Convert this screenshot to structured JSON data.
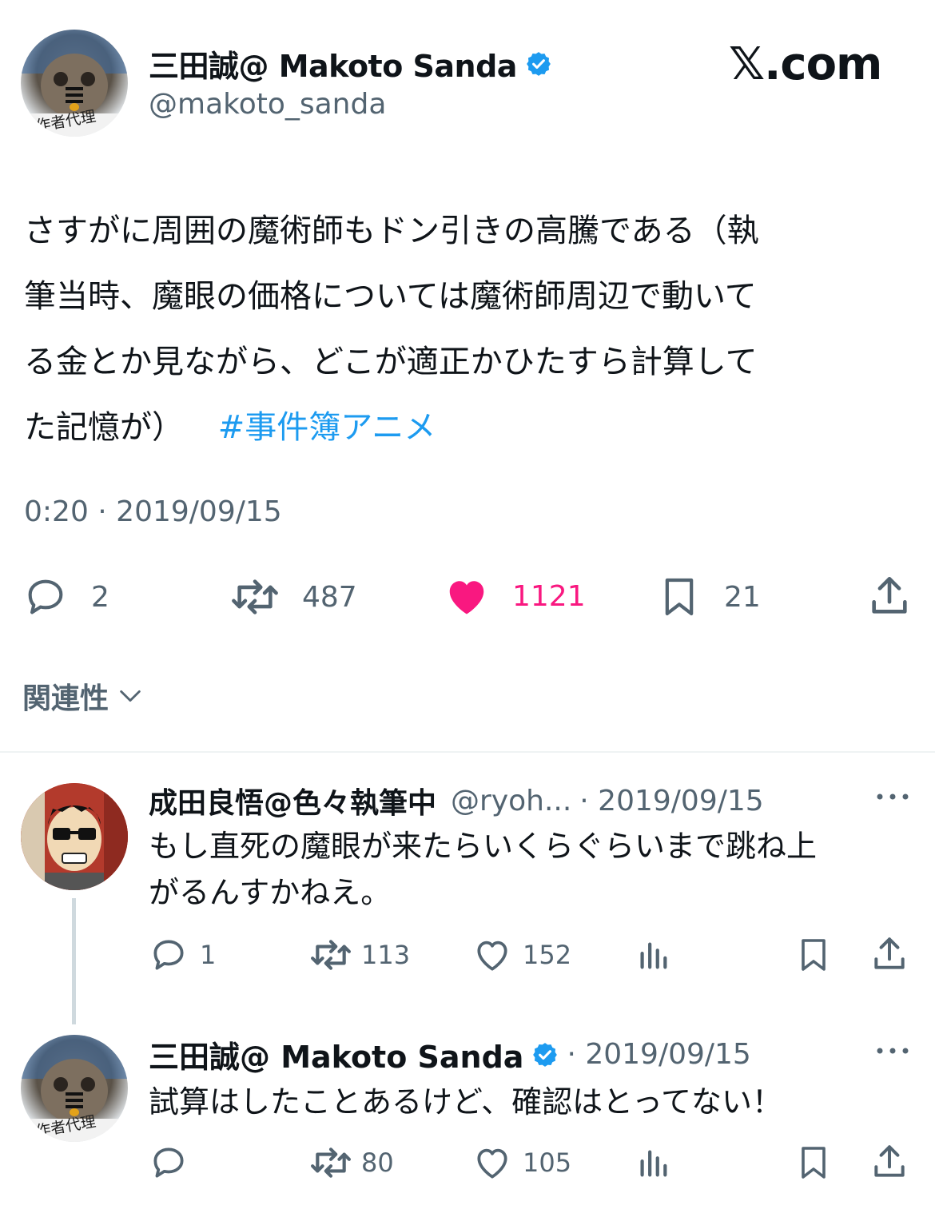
{
  "brand": {
    "site_label": "𝕏.com"
  },
  "main_tweet": {
    "author_name": "三田誠@ Makoto Sanda",
    "handle": "@makoto_sanda",
    "avatar_caption": "作者代理",
    "text_line1": "さすがに周囲の魔術師もドン引きの高騰である（執",
    "text_line2": "筆当時、魔眼の価格については魔術師周辺で動いて",
    "text_line3": "る金とか見ながら、どこが適正かひたすら計算して",
    "text_line4": "た記憶が）",
    "hashtag": "#事件簿アニメ",
    "timestamp": "0:20 · 2019/09/15",
    "stats": {
      "replies": "2",
      "retweets": "487",
      "likes": "1121",
      "bookmarks": "21"
    }
  },
  "related": {
    "label": "関連性"
  },
  "replies": [
    {
      "author_name": "成田良悟@色々執筆中",
      "handle": "@ryoh...",
      "date": "· 2019/09/15",
      "text_line1": "もし直死の魔眼が来たらいくらぐらいまで跳ね上",
      "text_line2": "がるんすかねえ。",
      "stats": {
        "replies": "1",
        "retweets": "113",
        "likes": "152"
      }
    },
    {
      "author_name": "三田誠@ Makoto Sanda",
      "date": "· 2019/09/15",
      "avatar_caption": "作者代理",
      "text_line1": "試算はしたことあるけど、確認はとってない！",
      "stats": {
        "replies": "",
        "retweets": "80",
        "likes": "105"
      }
    }
  ],
  "colors": {
    "accent": "#1d9bf0",
    "like": "#f91880",
    "muted": "#536471",
    "divider": "#eff3f4"
  }
}
